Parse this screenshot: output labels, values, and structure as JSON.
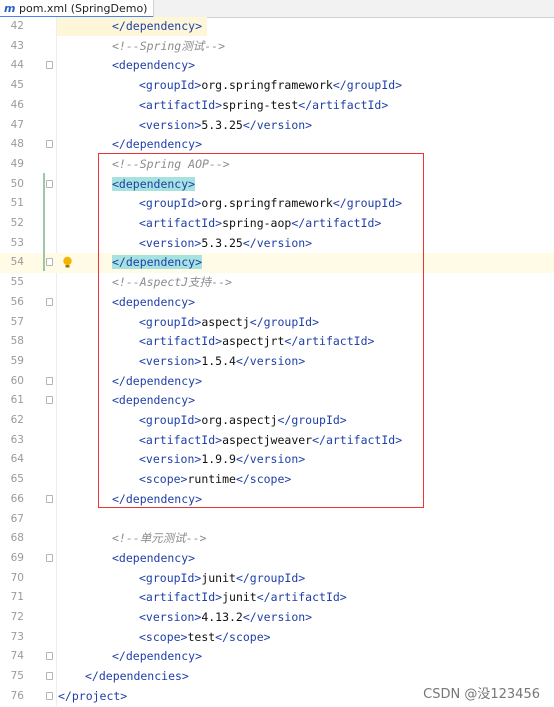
{
  "tab": {
    "icon": "maven-m-icon",
    "label": "pom.xml (SpringDemo)"
  },
  "lines": [
    {
      "n": "42",
      "indent": 2,
      "segs": [
        {
          "t": "tag",
          "v": "</dependency>"
        }
      ]
    },
    {
      "n": "43",
      "indent": 2,
      "segs": [
        {
          "t": "cmt",
          "v": "<!--Spring测试-->"
        }
      ]
    },
    {
      "n": "44",
      "indent": 2,
      "segs": [
        {
          "t": "tag",
          "v": "<dependency>"
        }
      ]
    },
    {
      "n": "45",
      "indent": 3,
      "segs": [
        {
          "t": "tag",
          "v": "<groupId>"
        },
        {
          "t": "txt",
          "v": "org.springframework"
        },
        {
          "t": "tag",
          "v": "</groupId>"
        }
      ]
    },
    {
      "n": "46",
      "indent": 3,
      "segs": [
        {
          "t": "tag",
          "v": "<artifactId>"
        },
        {
          "t": "txt",
          "v": "spring-test"
        },
        {
          "t": "tag",
          "v": "</artifactId>"
        }
      ]
    },
    {
      "n": "47",
      "indent": 3,
      "segs": [
        {
          "t": "tag",
          "v": "<version>"
        },
        {
          "t": "txt",
          "v": "5.3.25"
        },
        {
          "t": "tag",
          "v": "</version>"
        }
      ]
    },
    {
      "n": "48",
      "indent": 2,
      "segs": [
        {
          "t": "tag",
          "v": "</dependency>"
        }
      ]
    },
    {
      "n": "49",
      "indent": 2,
      "segs": [
        {
          "t": "cmt",
          "v": "<!--Spring AOP-->"
        }
      ]
    },
    {
      "n": "50",
      "indent": 2,
      "segs": [
        {
          "t": "hl",
          "v": "<dependency>"
        }
      ]
    },
    {
      "n": "51",
      "indent": 3,
      "segs": [
        {
          "t": "tag",
          "v": "<groupId>"
        },
        {
          "t": "txt",
          "v": "org.springframework"
        },
        {
          "t": "tag",
          "v": "</groupId>"
        }
      ]
    },
    {
      "n": "52",
      "indent": 3,
      "segs": [
        {
          "t": "tag",
          "v": "<artifactId>"
        },
        {
          "t": "txt",
          "v": "spring-aop"
        },
        {
          "t": "tag",
          "v": "</artifactId>"
        }
      ]
    },
    {
      "n": "53",
      "indent": 3,
      "segs": [
        {
          "t": "tag",
          "v": "<version>"
        },
        {
          "t": "txt",
          "v": "5.3.25"
        },
        {
          "t": "tag",
          "v": "</version>"
        }
      ]
    },
    {
      "n": "54",
      "indent": 2,
      "segs": [
        {
          "t": "hl",
          "v": "</dependency>"
        }
      ]
    },
    {
      "n": "55",
      "indent": 2,
      "segs": [
        {
          "t": "cmt",
          "v": "<!--AspectJ支持-->"
        }
      ]
    },
    {
      "n": "56",
      "indent": 2,
      "segs": [
        {
          "t": "tag",
          "v": "<dependency>"
        }
      ]
    },
    {
      "n": "57",
      "indent": 3,
      "segs": [
        {
          "t": "tag",
          "v": "<groupId>"
        },
        {
          "t": "txt",
          "v": "aspectj"
        },
        {
          "t": "tag",
          "v": "</groupId>"
        }
      ]
    },
    {
      "n": "58",
      "indent": 3,
      "segs": [
        {
          "t": "tag",
          "v": "<artifactId>"
        },
        {
          "t": "txt",
          "v": "aspectjrt"
        },
        {
          "t": "tag",
          "v": "</artifactId>"
        }
      ]
    },
    {
      "n": "59",
      "indent": 3,
      "segs": [
        {
          "t": "tag",
          "v": "<version>"
        },
        {
          "t": "txt",
          "v": "1.5.4"
        },
        {
          "t": "tag",
          "v": "</version>"
        }
      ]
    },
    {
      "n": "60",
      "indent": 2,
      "segs": [
        {
          "t": "tag",
          "v": "</dependency>"
        }
      ]
    },
    {
      "n": "61",
      "indent": 2,
      "segs": [
        {
          "t": "tag",
          "v": "<dependency>"
        }
      ]
    },
    {
      "n": "62",
      "indent": 3,
      "segs": [
        {
          "t": "tag",
          "v": "<groupId>"
        },
        {
          "t": "txt",
          "v": "org.aspectj"
        },
        {
          "t": "tag",
          "v": "</groupId>"
        }
      ]
    },
    {
      "n": "63",
      "indent": 3,
      "segs": [
        {
          "t": "tag",
          "v": "<artifactId>"
        },
        {
          "t": "txt",
          "v": "aspectjweaver"
        },
        {
          "t": "tag",
          "v": "</artifactId>"
        }
      ]
    },
    {
      "n": "64",
      "indent": 3,
      "segs": [
        {
          "t": "tag",
          "v": "<version>"
        },
        {
          "t": "txt",
          "v": "1.9.9"
        },
        {
          "t": "tag",
          "v": "</version>"
        }
      ]
    },
    {
      "n": "65",
      "indent": 3,
      "segs": [
        {
          "t": "tag",
          "v": "<scope>"
        },
        {
          "t": "txt",
          "v": "runtime"
        },
        {
          "t": "tag",
          "v": "</scope>"
        }
      ]
    },
    {
      "n": "66",
      "indent": 2,
      "segs": [
        {
          "t": "tag",
          "v": "</dependency>"
        }
      ]
    },
    {
      "n": "67",
      "indent": 0,
      "segs": []
    },
    {
      "n": "68",
      "indent": 2,
      "segs": [
        {
          "t": "cmt",
          "v": "<!--单元测试-->"
        }
      ]
    },
    {
      "n": "69",
      "indent": 2,
      "segs": [
        {
          "t": "tag",
          "v": "<dependency>"
        }
      ]
    },
    {
      "n": "70",
      "indent": 3,
      "segs": [
        {
          "t": "tag",
          "v": "<groupId>"
        },
        {
          "t": "txt",
          "v": "junit"
        },
        {
          "t": "tag",
          "v": "</groupId>"
        }
      ]
    },
    {
      "n": "71",
      "indent": 3,
      "segs": [
        {
          "t": "tag",
          "v": "<artifactId>"
        },
        {
          "t": "txt",
          "v": "junit"
        },
        {
          "t": "tag",
          "v": "</artifactId>"
        }
      ]
    },
    {
      "n": "72",
      "indent": 3,
      "segs": [
        {
          "t": "tag",
          "v": "<version>"
        },
        {
          "t": "txt",
          "v": "4.13.2"
        },
        {
          "t": "tag",
          "v": "</version>"
        }
      ]
    },
    {
      "n": "73",
      "indent": 3,
      "segs": [
        {
          "t": "tag",
          "v": "<scope>"
        },
        {
          "t": "txt",
          "v": "test"
        },
        {
          "t": "tag",
          "v": "</scope>"
        }
      ]
    },
    {
      "n": "74",
      "indent": 2,
      "segs": [
        {
          "t": "tag",
          "v": "</dependency>"
        }
      ]
    },
    {
      "n": "75",
      "indent": 1,
      "segs": [
        {
          "t": "tag",
          "v": "</dependencies>"
        }
      ]
    },
    {
      "n": "76",
      "indent": 0,
      "segs": [
        {
          "t": "tag",
          "v": "</project>"
        }
      ]
    }
  ],
  "folds": [
    "44",
    "48",
    "50",
    "54",
    "56",
    "60",
    "61",
    "66",
    "69",
    "74",
    "75",
    "76"
  ],
  "current_line": "54",
  "watermark": "CSDN @没123456",
  "colors": {
    "tag": "#1f3fa8",
    "comment": "#8c8c8c",
    "highlight": "#a6e3e0",
    "annotation_box": "#e33333"
  }
}
